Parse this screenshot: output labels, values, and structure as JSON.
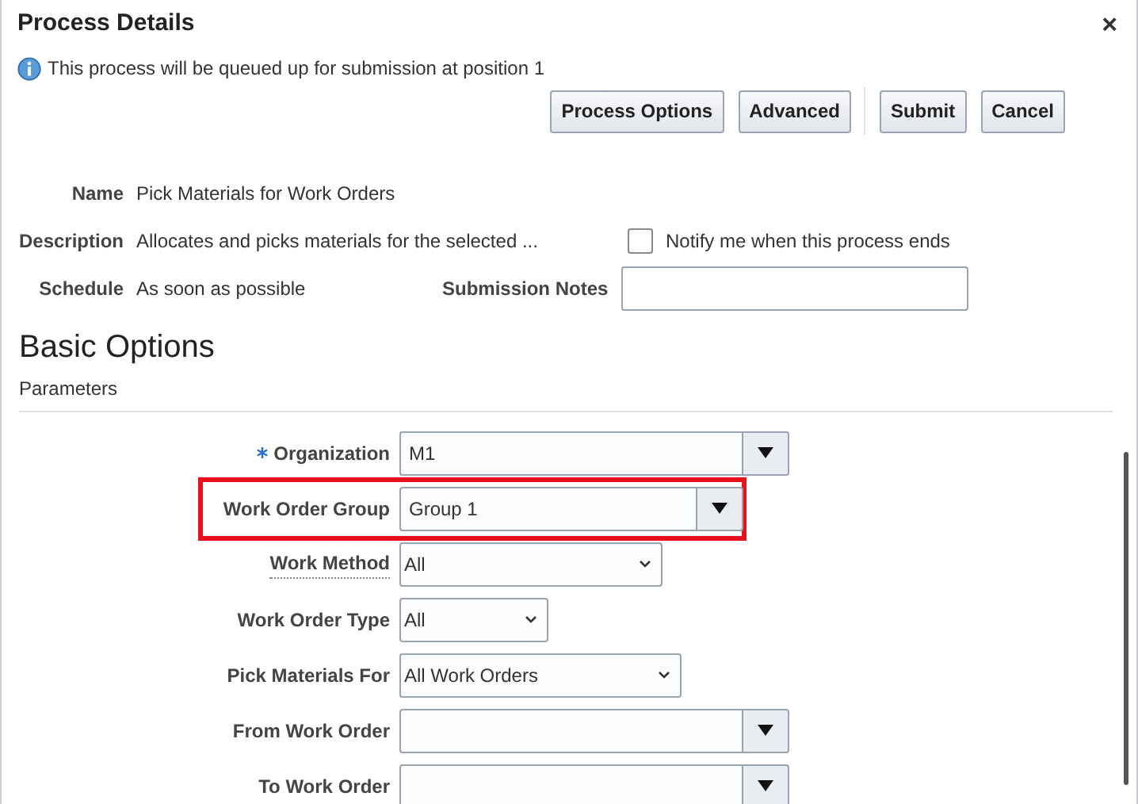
{
  "window": {
    "title": "Process Details",
    "close": "×"
  },
  "info": "This process will be queued up for submission at position 1",
  "buttons": [
    "Process Options",
    "Advanced",
    "Submit",
    "Cancel"
  ],
  "summary": [
    {
      "label": "Name",
      "value": "Pick Materials for Work Orders"
    },
    {
      "label": "Description",
      "value": "Allocates and picks materials for the selected ..."
    },
    {
      "label": "Schedule",
      "value": "As soon as possible"
    }
  ],
  "notify": {
    "label": "Notify me when this process ends",
    "checked": false
  },
  "notes": {
    "label": "Submission Notes"
  },
  "section": {
    "title": "Basic Options",
    "subtitle": "Parameters"
  },
  "parameters": [
    {
      "label": "Organization",
      "kind": "lov",
      "value": "M1",
      "required": true,
      "highlighted": false
    },
    {
      "label": "Work Order Group",
      "kind": "lov",
      "value": "Group 1",
      "required": false,
      "highlighted": true
    },
    {
      "label": "Work Method",
      "kind": "select",
      "value": "All",
      "required": false,
      "highlighted": false
    },
    {
      "label": "Work Order Type",
      "kind": "select",
      "value": "All",
      "required": false,
      "highlighted": false
    },
    {
      "label": "Pick Materials For",
      "kind": "select",
      "value": "All Work Orders",
      "required": false,
      "highlighted": false
    },
    {
      "label": "From Work Order",
      "kind": "lov",
      "required": false,
      "highlighted": false
    },
    {
      "label": "To Work Order",
      "kind": "lov",
      "required": false,
      "highlighted": false
    }
  ]
}
